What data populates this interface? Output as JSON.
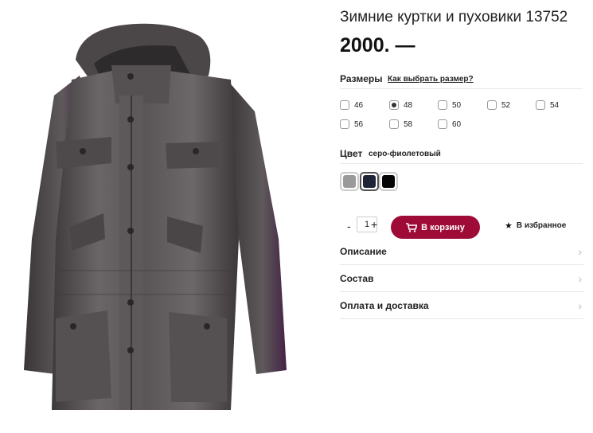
{
  "product": {
    "title": "Зимние куртки и пуховики 13752",
    "price": "2000. —"
  },
  "sizes": {
    "label": "Размеры",
    "guide_link": "Как выбрать размер?",
    "options": [
      "46",
      "48",
      "50",
      "52",
      "54",
      "56",
      "58",
      "60"
    ],
    "selected": "48"
  },
  "color": {
    "label": "Цвет",
    "value": "серо-фиолетовый",
    "swatches": [
      "#9a9a9a",
      "#1f2436",
      "#050505"
    ],
    "selected_index": 1
  },
  "quantity": {
    "minus": "-",
    "value": "1",
    "plus": "+"
  },
  "actions": {
    "cart_label": "В корзину",
    "cart_color": "#9e0b37",
    "favorite_label": "В избранное"
  },
  "accordion": {
    "description": "Описание",
    "composition": "Состав",
    "payment_delivery": "Оплата и доставка"
  },
  "icons": {
    "cart": "cart-icon",
    "star": "star-icon",
    "chevron": "chevron-right-icon"
  }
}
